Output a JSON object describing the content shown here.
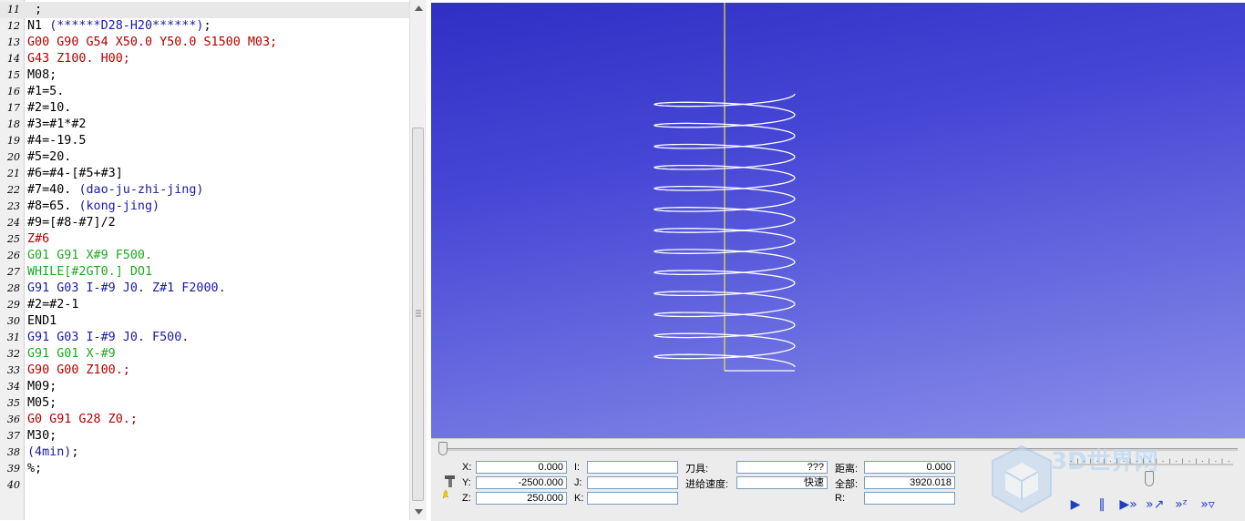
{
  "editor": {
    "lines": [
      {
        "n": "11",
        "segments": [
          {
            "text": " ;",
            "color": "black"
          }
        ],
        "highlight": true
      },
      {
        "n": "12",
        "segments": [
          {
            "text": "N1 ",
            "color": "black"
          },
          {
            "text": "(******D28-H20******)",
            "color": "blue"
          },
          {
            "text": ";",
            "color": "black"
          }
        ]
      },
      {
        "n": "13",
        "segments": [
          {
            "text": "G00 G90 G54 X50.0 Y50.0 S1500 M03;",
            "color": "red"
          }
        ]
      },
      {
        "n": "14",
        "segments": [
          {
            "text": "G43 Z100. H00;",
            "color": "red"
          }
        ]
      },
      {
        "n": "15",
        "segments": [
          {
            "text": "M08;",
            "color": "black"
          }
        ]
      },
      {
        "n": "16",
        "segments": [
          {
            "text": "#1=5.",
            "color": "black"
          }
        ]
      },
      {
        "n": "17",
        "segments": [
          {
            "text": "#2=10.",
            "color": "black"
          }
        ]
      },
      {
        "n": "18",
        "segments": [
          {
            "text": "#3=#1*#2",
            "color": "black"
          }
        ]
      },
      {
        "n": "19",
        "segments": [
          {
            "text": "#4=-19.5",
            "color": "black"
          }
        ]
      },
      {
        "n": "20",
        "segments": [
          {
            "text": "#5=20.",
            "color": "black"
          }
        ]
      },
      {
        "n": "21",
        "segments": [
          {
            "text": "#6=#4-[#5+#3]",
            "color": "black"
          }
        ]
      },
      {
        "n": "22",
        "segments": [
          {
            "text": "#7=40. ",
            "color": "black"
          },
          {
            "text": "(dao-ju-zhi-jing)",
            "color": "blue"
          }
        ]
      },
      {
        "n": "23",
        "segments": [
          {
            "text": "#8=65. ",
            "color": "black"
          },
          {
            "text": "(kong-jing)",
            "color": "blue"
          }
        ]
      },
      {
        "n": "24",
        "segments": [
          {
            "text": "#9=[#8-#7]/2",
            "color": "black"
          }
        ]
      },
      {
        "n": "25",
        "segments": [
          {
            "text": "Z#6",
            "color": "red"
          }
        ]
      },
      {
        "n": "26",
        "segments": [
          {
            "text": "G01 G91 X#9 F500.",
            "color": "green"
          }
        ]
      },
      {
        "n": "27",
        "segments": [
          {
            "text": "WHILE[#2GT0.] DO1",
            "color": "green"
          }
        ]
      },
      {
        "n": "28",
        "segments": [
          {
            "text": "G91 G03 I-#9 J0. Z#1 F2000.",
            "color": "blue"
          }
        ]
      },
      {
        "n": "29",
        "segments": [
          {
            "text": "#2=#2-1",
            "color": "black"
          }
        ]
      },
      {
        "n": "30",
        "segments": [
          {
            "text": "END1",
            "color": "black"
          }
        ]
      },
      {
        "n": "31",
        "segments": [
          {
            "text": "G91 G03 I-#9 J0. F500.",
            "color": "blue"
          }
        ]
      },
      {
        "n": "32",
        "segments": [
          {
            "text": "G91 G01 X-#9",
            "color": "green"
          }
        ]
      },
      {
        "n": "33",
        "segments": [
          {
            "text": "G90 G00 Z100.;",
            "color": "red"
          }
        ]
      },
      {
        "n": "34",
        "segments": [
          {
            "text": "M09;",
            "color": "black"
          }
        ]
      },
      {
        "n": "35",
        "segments": [
          {
            "text": "M05;",
            "color": "black"
          }
        ]
      },
      {
        "n": "36",
        "segments": [
          {
            "text": "G0 G91 G28 Z0.;",
            "color": "red"
          }
        ]
      },
      {
        "n": "37",
        "segments": [
          {
            "text": "M30;",
            "color": "black"
          }
        ]
      },
      {
        "n": "38",
        "segments": [
          {
            "text": "(4min)",
            "color": "blue"
          },
          {
            "text": ";",
            "color": "black"
          }
        ]
      },
      {
        "n": "39",
        "segments": [
          {
            "text": "%;",
            "color": "black"
          }
        ]
      },
      {
        "n": "40",
        "segments": []
      }
    ]
  },
  "scrollbar": {
    "up_icon": "arrow-up-icon",
    "down_icon": "arrow-down-icon"
  },
  "viewport": {
    "helix_turns": 13,
    "colors": {
      "bg_top": "#2f2fc4",
      "bg_bottom": "#8a8fea",
      "toolpath": "#ffffff",
      "spindle_axis": "#e8e83a"
    }
  },
  "status": {
    "x_label": "X:",
    "x_value": "0.000",
    "y_label": "Y:",
    "y_value": "-2500.000",
    "z_label": "Z:",
    "z_value": "250.000",
    "i_label": "I:",
    "i_value": "",
    "j_label": "J:",
    "j_value": "",
    "k_label": "K:",
    "k_value": "",
    "tool_label": "刀具:",
    "tool_value": "???",
    "feed_label": "进给速度:",
    "feed_value": "快速",
    "dist_label": "距离:",
    "dist_value": "0.000",
    "total_label": "全部:",
    "total_value": "3920.018",
    "r_label": "R:",
    "r_value": ""
  },
  "progress": {
    "fraction": 0.0
  },
  "speed_slider": {
    "fraction": 0.49
  },
  "logo": {
    "text": "3D世界网",
    "icon": "cube-logo-icon"
  },
  "controls": [
    {
      "name": "play-button",
      "icon": "play-icon",
      "glyph": "▶"
    },
    {
      "name": "pause-button",
      "icon": "pause-icon",
      "glyph": "‖"
    },
    {
      "name": "step-button",
      "icon": "step-forward-icon",
      "glyph": "▶»"
    },
    {
      "name": "step-xy-button",
      "icon": "step-xy-icon",
      "glyph": "»↗"
    },
    {
      "name": "step-z-button",
      "icon": "step-z-icon",
      "glyph": "»ᶻ"
    },
    {
      "name": "step-tool-button",
      "icon": "step-tool-icon",
      "glyph": "»▿"
    }
  ]
}
